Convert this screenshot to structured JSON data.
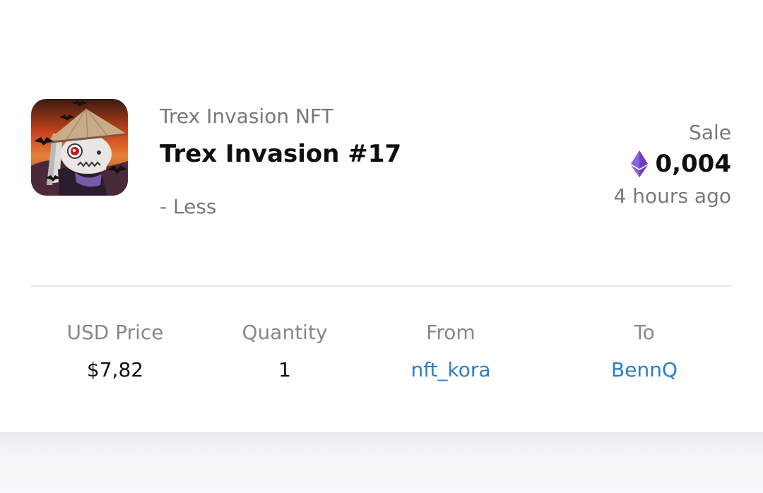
{
  "item": {
    "collection": "Trex Invasion NFT",
    "title": "Trex Invasion #17",
    "toggle_label": "- Less",
    "thumbnail_icon": "nft-artwork-image"
  },
  "sale": {
    "label": "Sale",
    "price": "0,004",
    "currency_icon": "ethereum-icon",
    "time": "4 hours ago"
  },
  "details": {
    "usd_price": {
      "label": "USD Price",
      "value": "$7,82"
    },
    "quantity": {
      "label": "Quantity",
      "value": "1"
    },
    "from": {
      "label": "From",
      "value": "nft_kora"
    },
    "to": {
      "label": "To",
      "value": "BennQ"
    }
  },
  "colors": {
    "link": "#2a7fc7",
    "muted_text": "#75787d",
    "primary_text": "#0f0f10",
    "ethereum": "#7b4fd6"
  }
}
